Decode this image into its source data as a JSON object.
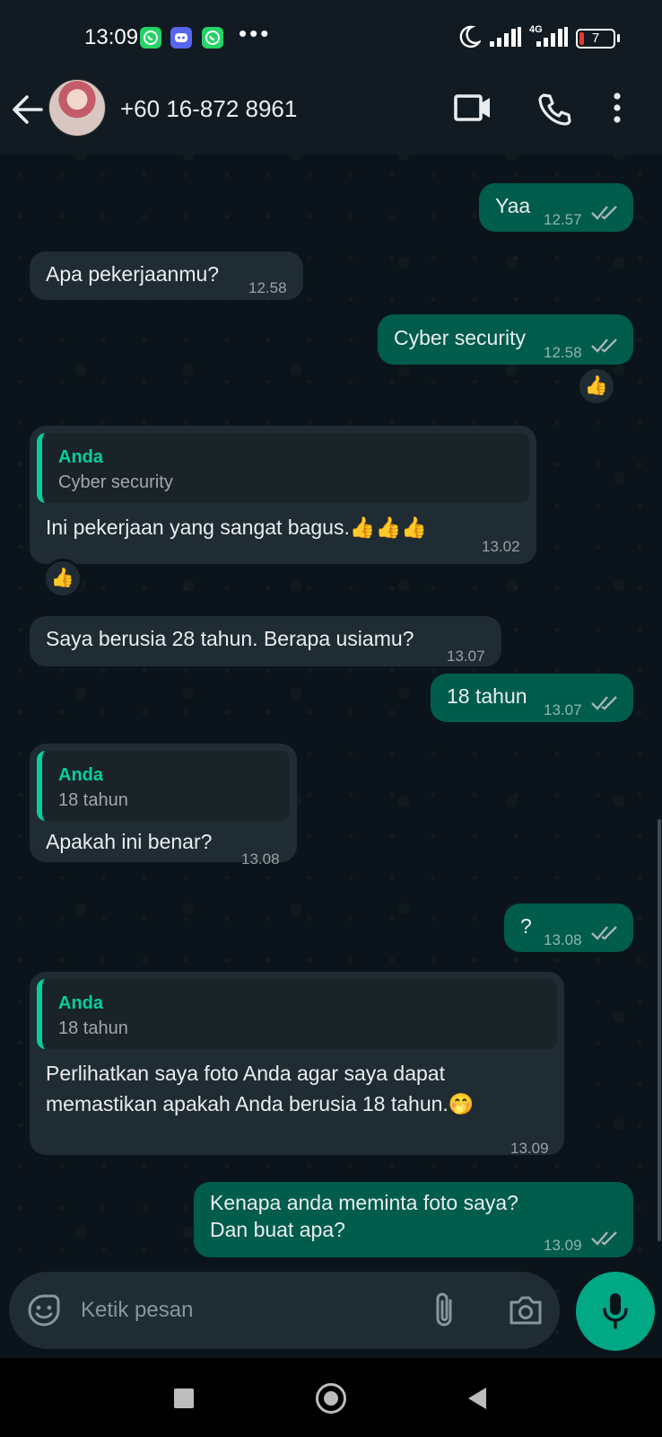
{
  "status_bar": {
    "time": "13:09",
    "network": "4G",
    "battery": "7"
  },
  "header": {
    "contact": "+60 16-872 8961"
  },
  "icons": {
    "back": "arrow-left-icon",
    "video": "video-camera-icon",
    "call": "phone-icon",
    "menu": "more-vert-icon",
    "emoji": "emoji-icon",
    "attach": "paperclip-icon",
    "camera": "camera-icon",
    "mic": "microphone-icon"
  },
  "colors": {
    "incoming": "#202c33",
    "outgoing": "#005c4b",
    "accent": "#00a884",
    "quote_bar": "#06cf9c",
    "background": "#0b141a"
  },
  "messages": [
    {
      "dir": "out",
      "text": "Yaa",
      "time": "12.57",
      "status": "read"
    },
    {
      "dir": "in",
      "text": "Apa pekerjaanmu?",
      "time": "12.58"
    },
    {
      "dir": "out",
      "text": "Cyber security",
      "time": "12.58",
      "status": "read",
      "reaction": "👍"
    },
    {
      "dir": "in",
      "quote_author": "Anda",
      "quote_text": "Cyber security",
      "text": "Ini pekerjaan yang sangat bagus.",
      "emojis": "👍👍👍",
      "time": "13.02",
      "reaction": "👍"
    },
    {
      "dir": "in",
      "text": "Saya berusia 28 tahun. Berapa usiamu?",
      "time": "13.07"
    },
    {
      "dir": "out",
      "text": "18 tahun",
      "time": "13.07",
      "status": "read"
    },
    {
      "dir": "in",
      "quote_author": "Anda",
      "quote_text": "18 tahun",
      "text": "Apakah ini benar?",
      "time": "13.08"
    },
    {
      "dir": "out",
      "text": "?",
      "time": "13.08",
      "status": "read"
    },
    {
      "dir": "in",
      "quote_author": "Anda",
      "quote_text": "18 tahun",
      "text_line1": "Perlihatkan saya foto Anda agar saya dapat",
      "text_line2": "memastikan apakah Anda berusia 18 tahun.",
      "emojis": "🤭",
      "time": "13.09"
    },
    {
      "dir": "out",
      "text_line1": "Kenapa anda meminta foto saya?",
      "text_line2": "Dan buat apa?",
      "time": "13.09",
      "status": "read"
    }
  ],
  "composer": {
    "placeholder": "Ketik pesan"
  }
}
